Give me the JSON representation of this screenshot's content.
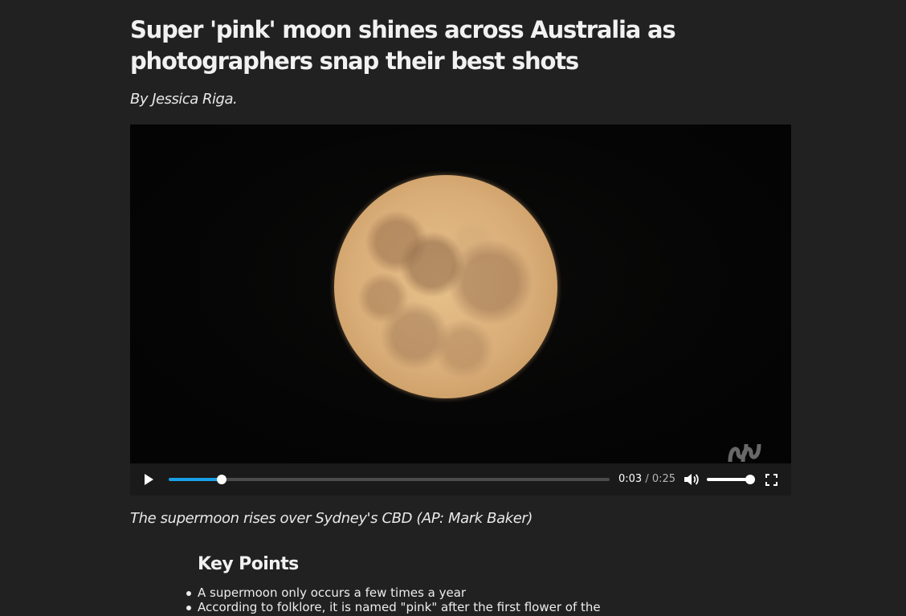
{
  "article": {
    "headline": "Super 'pink' moon shines across Australia as photographers snap their best shots",
    "byline": "By Jessica Riga.",
    "caption": "The supermoon rises over Sydney's CBD (AP: Mark Baker)"
  },
  "video": {
    "current_time": "0:03",
    "separator": "/",
    "duration": "0:25",
    "progress": 0.12,
    "volume": 1.0,
    "logo": "abc-logo",
    "accent_color": "#1aa0e6"
  },
  "key_points": {
    "title": "Key Points",
    "items": [
      "A supermoon only occurs a few times a year",
      "According to folklore, it is named \"pink\" after the first flower of the"
    ]
  },
  "colors": {
    "background": "#212121",
    "text": "#ededed"
  }
}
